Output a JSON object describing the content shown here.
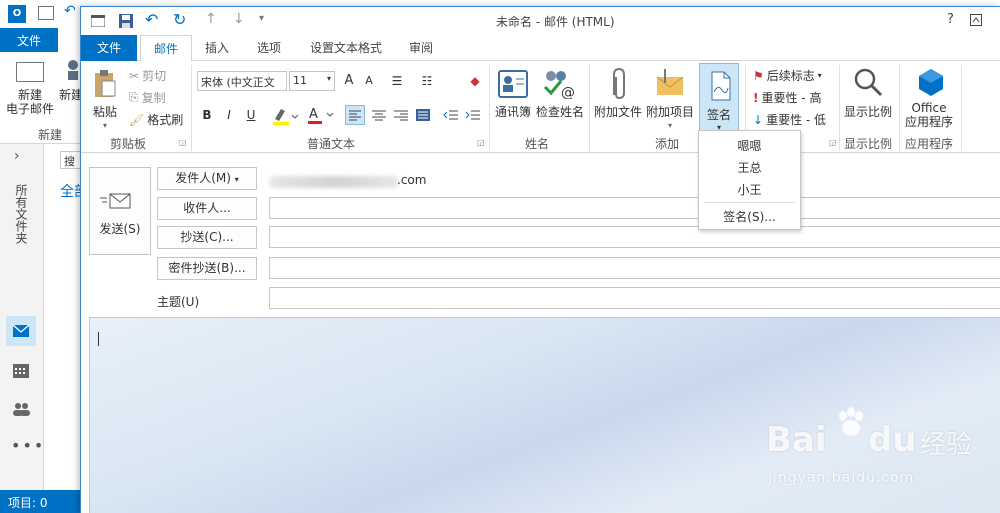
{
  "background_window": {
    "file_tab": "文件",
    "new_email": "新建\n电子邮件",
    "new_email_line1": "新建",
    "new_email_line2": "电子邮件",
    "new_other": "新建",
    "group_new": "新建",
    "search_partial": "搜",
    "all_partial": "全部",
    "folder_pane_label": "所有文件夹",
    "status": "项目: 0"
  },
  "window": {
    "title": "未命名 - 邮件 (HTML)",
    "help": "?"
  },
  "tabs": [
    "文件",
    "邮件",
    "插入",
    "选项",
    "设置文本格式",
    "审阅"
  ],
  "ribbon": {
    "clipboard": {
      "paste": "粘贴",
      "cut": "剪切",
      "copy": "复制",
      "format_painter": "格式刷",
      "label": "剪贴板"
    },
    "basic_text": {
      "font": "宋体 (中文正文",
      "size": "11",
      "bold": "B",
      "italic": "I",
      "underline": "U",
      "grow": "A",
      "shrink": "A",
      "label": "普通文本"
    },
    "names": {
      "address_book": "通讯簿",
      "check_names": "检查姓名",
      "label": "姓名"
    },
    "include": {
      "attach_file": "附加文件",
      "attach_item": "附加项目",
      "signature": "签名",
      "label": "添加"
    },
    "tags": {
      "follow_up": "后续标志",
      "high_importance": "重要性 - 高",
      "low_importance": "重要性 - 低"
    },
    "zoom": {
      "zoom": "显示比例",
      "label": "显示比例"
    },
    "apps": {
      "office_apps": "Office\n应用程序",
      "office_apps_line1": "Office",
      "office_apps_line2": "应用程序",
      "label": "应用程序"
    }
  },
  "header": {
    "send": "发送(S)",
    "from": "发件人(M)",
    "from_value": ".com",
    "to": "收件人...",
    "cc": "抄送(C)...",
    "bcc": "密件抄送(B)...",
    "subject": "主题(U)"
  },
  "signature_menu": {
    "items": [
      "嗯嗯",
      "王总",
      "小王"
    ],
    "manage": "签名(S)..."
  },
  "watermark": {
    "brand": "Bai",
    "brand2": "du",
    "cn": "经验",
    "url": "jingyan.baidu.com"
  },
  "colors": {
    "accent": "#0072c6",
    "highlight": "#cde6f7"
  }
}
